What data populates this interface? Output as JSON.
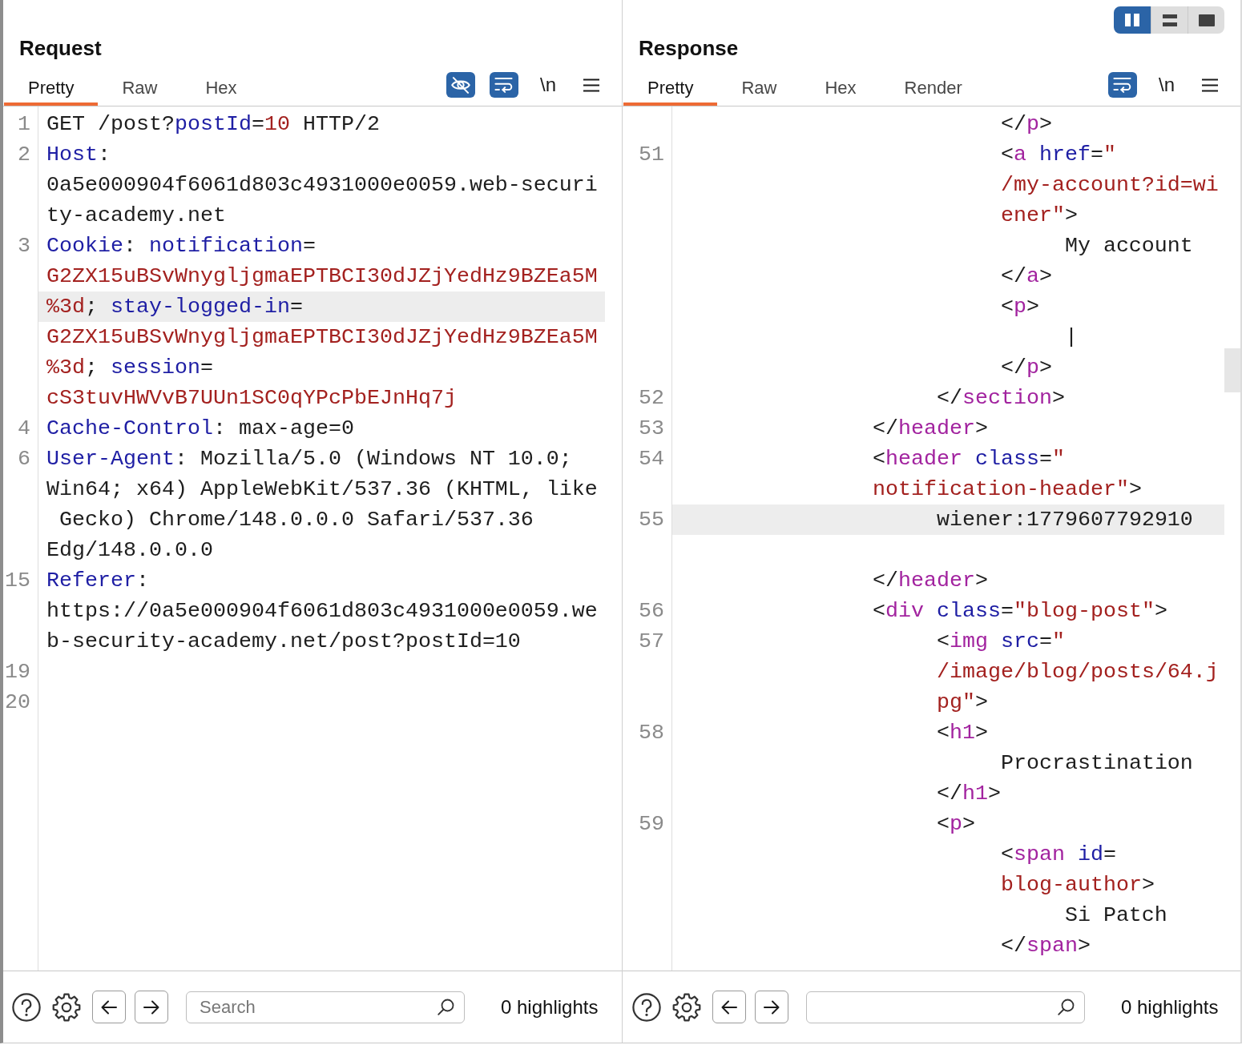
{
  "panes": [
    {
      "title": "Request",
      "tabs": [
        {
          "label": "Pretty",
          "selected": true
        },
        {
          "label": "Raw",
          "selected": false
        },
        {
          "label": "Hex",
          "selected": false
        }
      ],
      "toolbar": [
        {
          "kind": "hide",
          "on": true
        },
        {
          "kind": "wrap",
          "on": true
        },
        {
          "kind": "newline",
          "label": "\\n",
          "on": false
        },
        {
          "kind": "menu"
        }
      ],
      "lines": [
        {
          "number": "1",
          "rows": [
            {
              "highlighted": false,
              "segments": [
                {
                  "kind": "text",
                  "text": "GET /post?"
                },
                {
                  "kind": "key",
                  "text": "postId"
                },
                {
                  "kind": "text",
                  "text": "="
                },
                {
                  "kind": "value",
                  "text": "10"
                },
                {
                  "kind": "text",
                  "text": " HTTP/2"
                }
              ]
            }
          ]
        },
        {
          "number": "2",
          "rows": [
            {
              "highlighted": false,
              "segments": [
                {
                  "kind": "key",
                  "text": "Host"
                },
                {
                  "kind": "text",
                  "text": ":"
                }
              ]
            },
            {
              "highlighted": false,
              "segments": [
                {
                  "kind": "text",
                  "text": "0a5e000904f6061d803c4931000e0059.web-securi"
                }
              ]
            },
            {
              "highlighted": false,
              "segments": [
                {
                  "kind": "text",
                  "text": "ty-academy.net"
                }
              ]
            }
          ]
        },
        {
          "number": "3",
          "rows": [
            {
              "highlighted": false,
              "segments": [
                {
                  "kind": "key",
                  "text": "Cookie"
                },
                {
                  "kind": "text",
                  "text": ": "
                },
                {
                  "kind": "key",
                  "text": "notification"
                },
                {
                  "kind": "text",
                  "text": "="
                }
              ]
            },
            {
              "highlighted": false,
              "segments": [
                {
                  "kind": "value",
                  "text": "G2ZX15uBSvWnygljgmaEPTBCI30dJZjYedHz9BZEa5M"
                }
              ]
            },
            {
              "highlighted": true,
              "segments": [
                {
                  "kind": "value",
                  "text": "%3d"
                },
                {
                  "kind": "text",
                  "text": "; "
                },
                {
                  "kind": "key",
                  "text": "stay-logged-in"
                },
                {
                  "kind": "text",
                  "text": "="
                }
              ]
            },
            {
              "highlighted": false,
              "segments": [
                {
                  "kind": "value",
                  "text": "G2ZX15uBSvWnygljgmaEPTBCI30dJZjYedHz9BZEa5M"
                }
              ]
            },
            {
              "highlighted": false,
              "segments": [
                {
                  "kind": "value",
                  "text": "%3d"
                },
                {
                  "kind": "text",
                  "text": "; "
                },
                {
                  "kind": "key",
                  "text": "session"
                },
                {
                  "kind": "text",
                  "text": "="
                }
              ]
            },
            {
              "highlighted": false,
              "segments": [
                {
                  "kind": "value",
                  "text": "cS3tuvHWVvB7UUn1SC0qYPcPbEJnHq7j"
                }
              ]
            }
          ]
        },
        {
          "number": "4",
          "rows": [
            {
              "highlighted": false,
              "segments": [
                {
                  "kind": "key",
                  "text": "Cache-Control"
                },
                {
                  "kind": "text",
                  "text": ": max-age=0"
                }
              ]
            }
          ]
        },
        {
          "number": "6",
          "rows": [
            {
              "highlighted": false,
              "segments": [
                {
                  "kind": "key",
                  "text": "User-Agent"
                },
                {
                  "kind": "text",
                  "text": ": Mozilla/5.0 (Windows NT 10.0;"
                }
              ]
            },
            {
              "highlighted": false,
              "segments": [
                {
                  "kind": "text",
                  "text": "Win64; x64) AppleWebKit/537.36 (KHTML, like"
                }
              ]
            },
            {
              "highlighted": false,
              "segments": [
                {
                  "kind": "text",
                  "text": " Gecko) Chrome/148.0.0.0 Safari/537.36"
                }
              ]
            },
            {
              "highlighted": false,
              "segments": [
                {
                  "kind": "text",
                  "text": "Edg/148.0.0.0"
                }
              ]
            }
          ]
        },
        {
          "number": "15",
          "rows": [
            {
              "highlighted": false,
              "segments": [
                {
                  "kind": "key",
                  "text": "Referer"
                },
                {
                  "kind": "text",
                  "text": ":"
                }
              ]
            },
            {
              "highlighted": false,
              "segments": [
                {
                  "kind": "text",
                  "text": "https://0a5e000904f6061d803c4931000e0059.we"
                }
              ]
            },
            {
              "highlighted": false,
              "segments": [
                {
                  "kind": "text",
                  "text": "b-security-academy.net/post?postId=10"
                }
              ]
            }
          ]
        },
        {
          "number": "19",
          "rows": [
            {
              "highlighted": false
            }
          ]
        },
        {
          "number": "20",
          "rows": [
            {
              "highlighted": false
            }
          ]
        }
      ],
      "search": {
        "placeholder": "Search"
      },
      "highlights": "0 highlights"
    },
    {
      "layout_toggle": [
        {
          "kind": "split",
          "selected": true
        },
        {
          "kind": "stack",
          "selected": false
        },
        {
          "kind": "single",
          "selected": false
        }
      ],
      "title": "Response",
      "tabs": [
        {
          "label": "Pretty",
          "selected": true
        },
        {
          "label": "Raw",
          "selected": false
        },
        {
          "label": "Hex",
          "selected": false
        },
        {
          "label": "Render",
          "selected": false
        }
      ],
      "toolbar": [
        {
          "kind": "wrap",
          "on": true
        },
        {
          "kind": "newline",
          "label": "\\n",
          "on": false
        },
        {
          "kind": "menu"
        }
      ],
      "lines": [
        {
          "rows": [
            {
              "highlighted": false,
              "segments": [
                {
                  "kind": "text",
                  "text": "                         </"
                },
                {
                  "kind": "tag",
                  "text": "p"
                },
                {
                  "kind": "text",
                  "text": ">"
                }
              ]
            }
          ]
        },
        {
          "number": "51",
          "rows": [
            {
              "highlighted": false,
              "segments": [
                {
                  "kind": "text",
                  "text": "                         <"
                },
                {
                  "kind": "tag",
                  "text": "a"
                },
                {
                  "kind": "key",
                  "text": " href"
                },
                {
                  "kind": "text",
                  "text": "="
                },
                {
                  "kind": "value",
                  "text": "\""
                }
              ]
            },
            {
              "highlighted": false,
              "segments": [
                {
                  "kind": "value",
                  "text": "                         /my-account?id=wi"
                }
              ]
            },
            {
              "highlighted": false,
              "segments": [
                {
                  "kind": "value",
                  "text": "                         ener\""
                },
                {
                  "kind": "text",
                  "text": ">"
                }
              ]
            },
            {
              "highlighted": false,
              "segments": [
                {
                  "kind": "text",
                  "text": "                              My account"
                }
              ]
            },
            {
              "highlighted": false,
              "segments": [
                {
                  "kind": "text",
                  "text": "                         </"
                },
                {
                  "kind": "tag",
                  "text": "a"
                },
                {
                  "kind": "text",
                  "text": ">"
                }
              ]
            },
            {
              "highlighted": false,
              "segments": [
                {
                  "kind": "text",
                  "text": "                         <"
                },
                {
                  "kind": "tag",
                  "text": "p"
                },
                {
                  "kind": "text",
                  "text": ">"
                }
              ]
            },
            {
              "highlighted": false,
              "segments": [
                {
                  "kind": "text",
                  "text": "                              |"
                }
              ]
            },
            {
              "highlighted": false,
              "segments": [
                {
                  "kind": "text",
                  "text": "                         </"
                },
                {
                  "kind": "tag",
                  "text": "p"
                },
                {
                  "kind": "text",
                  "text": ">"
                }
              ]
            }
          ]
        },
        {
          "number": "52",
          "rows": [
            {
              "highlighted": false,
              "segments": [
                {
                  "kind": "text",
                  "text": "                    </"
                },
                {
                  "kind": "tag",
                  "text": "section"
                },
                {
                  "kind": "text",
                  "text": ">"
                }
              ]
            }
          ]
        },
        {
          "number": "53",
          "rows": [
            {
              "highlighted": false,
              "segments": [
                {
                  "kind": "text",
                  "text": "               </"
                },
                {
                  "kind": "tag",
                  "text": "header"
                },
                {
                  "kind": "text",
                  "text": ">"
                }
              ]
            }
          ]
        },
        {
          "number": "54",
          "rows": [
            {
              "highlighted": false,
              "segments": [
                {
                  "kind": "text",
                  "text": "               <"
                },
                {
                  "kind": "tag",
                  "text": "header"
                },
                {
                  "kind": "key",
                  "text": " class"
                },
                {
                  "kind": "text",
                  "text": "="
                },
                {
                  "kind": "value",
                  "text": "\""
                }
              ]
            },
            {
              "highlighted": false,
              "segments": [
                {
                  "kind": "value",
                  "text": "               notification-header\""
                },
                {
                  "kind": "text",
                  "text": ">"
                }
              ]
            }
          ]
        },
        {
          "number": "55",
          "rows": [
            {
              "highlighted": true,
              "segments": [
                {
                  "kind": "text",
                  "text": "                    wiener:1779607792910"
                }
              ]
            },
            {
              "highlighted": false
            },
            {
              "highlighted": false,
              "segments": [
                {
                  "kind": "text",
                  "text": "               </"
                },
                {
                  "kind": "tag",
                  "text": "header"
                },
                {
                  "kind": "text",
                  "text": ">"
                }
              ]
            }
          ]
        },
        {
          "number": "56",
          "rows": [
            {
              "highlighted": false,
              "segments": [
                {
                  "kind": "text",
                  "text": "               <"
                },
                {
                  "kind": "tag",
                  "text": "div"
                },
                {
                  "kind": "key",
                  "text": " class"
                },
                {
                  "kind": "text",
                  "text": "="
                },
                {
                  "kind": "value",
                  "text": "\"blog-post\""
                },
                {
                  "kind": "text",
                  "text": ">"
                }
              ]
            }
          ]
        },
        {
          "number": "57",
          "rows": [
            {
              "highlighted": false,
              "segments": [
                {
                  "kind": "text",
                  "text": "                    <"
                },
                {
                  "kind": "tag",
                  "text": "img"
                },
                {
                  "kind": "key",
                  "text": " src"
                },
                {
                  "kind": "text",
                  "text": "="
                },
                {
                  "kind": "value",
                  "text": "\""
                }
              ]
            },
            {
              "highlighted": false,
              "segments": [
                {
                  "kind": "value",
                  "text": "                    /image/blog/posts/64.j"
                }
              ]
            },
            {
              "highlighted": false,
              "segments": [
                {
                  "kind": "value",
                  "text": "                    pg\""
                },
                {
                  "kind": "text",
                  "text": ">"
                }
              ]
            }
          ]
        },
        {
          "number": "58",
          "rows": [
            {
              "highlighted": false,
              "segments": [
                {
                  "kind": "text",
                  "text": "                    <"
                },
                {
                  "kind": "tag",
                  "text": "h1"
                },
                {
                  "kind": "text",
                  "text": ">"
                }
              ]
            },
            {
              "highlighted": false,
              "segments": [
                {
                  "kind": "text",
                  "text": "                         Procrastination"
                }
              ]
            },
            {
              "highlighted": false,
              "segments": [
                {
                  "kind": "text",
                  "text": "                    </"
                },
                {
                  "kind": "tag",
                  "text": "h1"
                },
                {
                  "kind": "text",
                  "text": ">"
                }
              ]
            }
          ]
        },
        {
          "number": "59",
          "rows": [
            {
              "highlighted": false,
              "segments": [
                {
                  "kind": "text",
                  "text": "                    <"
                },
                {
                  "kind": "tag",
                  "text": "p"
                },
                {
                  "kind": "text",
                  "text": ">"
                }
              ]
            },
            {
              "highlighted": false,
              "segments": [
                {
                  "kind": "text",
                  "text": "                         <"
                },
                {
                  "kind": "tag",
                  "text": "span"
                },
                {
                  "kind": "key",
                  "text": " id"
                },
                {
                  "kind": "text",
                  "text": "="
                }
              ]
            },
            {
              "highlighted": false,
              "segments": [
                {
                  "kind": "value",
                  "text": "                         blog-author"
                },
                {
                  "kind": "text",
                  "text": ">"
                }
              ]
            },
            {
              "highlighted": false,
              "segments": [
                {
                  "kind": "text",
                  "text": "                              Si Patch"
                }
              ]
            },
            {
              "highlighted": false,
              "segments": [
                {
                  "kind": "text",
                  "text": "                         </"
                },
                {
                  "kind": "tag",
                  "text": "span"
                },
                {
                  "kind": "text",
                  "text": ">"
                }
              ]
            }
          ]
        }
      ],
      "highlights": "0 highlights"
    }
  ]
}
